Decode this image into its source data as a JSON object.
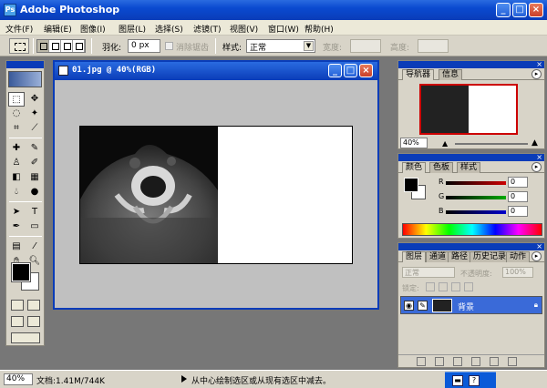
{
  "app": {
    "title": "Adobe Photoshop",
    "icon": "Ps"
  },
  "window_controls": {
    "minimize": "_",
    "maximize": "□",
    "close": "×"
  },
  "menu": [
    "文件(F)",
    "编辑(E)",
    "图像(I)",
    "图层(L)",
    "选择(S)",
    "滤镜(T)",
    "视图(V)",
    "窗口(W)",
    "帮助(H)"
  ],
  "options": {
    "feather_label": "羽化:",
    "feather_value": "0 px",
    "antialias_label": "消除锯齿",
    "style_label": "样式:",
    "style_value": "正常",
    "width_label": "宽度:",
    "height_label": "高度:"
  },
  "document": {
    "title": "01.jpg @ 40%(RGB)"
  },
  "navigator": {
    "tabs": [
      "导航器",
      "信息"
    ],
    "zoom": "40%"
  },
  "color": {
    "tabs": [
      "颜色",
      "色板",
      "样式"
    ],
    "channels": [
      {
        "label": "R",
        "value": "0",
        "color": "#cc0000"
      },
      {
        "label": "G",
        "value": "0",
        "color": "#00aa00"
      },
      {
        "label": "B",
        "value": "0",
        "color": "#0000cc"
      }
    ]
  },
  "layers": {
    "tabs": [
      "图层",
      "通道",
      "路径",
      "历史记录",
      "动作"
    ],
    "blend_mode": "正常",
    "opacity_label": "不透明度:",
    "opacity_value": "100%",
    "lock_label": "锁定:",
    "layer_name": "背景"
  },
  "status": {
    "zoom": "40%",
    "doc_info": "文档:1.41M/744K",
    "hint": "从中心绘制选区或从现有选区中减去。"
  }
}
